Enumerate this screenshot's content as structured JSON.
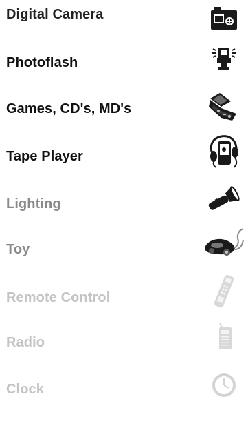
{
  "items": [
    {
      "label": "Digital Camera",
      "icon": "digital-camera-icon",
      "color": "#222222"
    },
    {
      "label": "Photoflash",
      "icon": "photoflash-icon",
      "color": "#111111"
    },
    {
      "label": "Games, CD's, MD's",
      "icon": "handheld-game-icon",
      "color": "#111111"
    },
    {
      "label": "Tape Player",
      "icon": "tape-player-icon",
      "color": "#111111"
    },
    {
      "label": "Lighting",
      "icon": "flashlight-icon",
      "color": "#8a8a8a"
    },
    {
      "label": "Toy",
      "icon": "toy-car-icon",
      "color": "#8a8a8a"
    },
    {
      "label": "Remote Control",
      "icon": "remote-control-icon",
      "color": "#c4c4c4"
    },
    {
      "label": "Radio",
      "icon": "radio-icon",
      "color": "#c4c4c4"
    },
    {
      "label": "Clock",
      "icon": "clock-icon",
      "color": "#c4c4c4"
    }
  ]
}
